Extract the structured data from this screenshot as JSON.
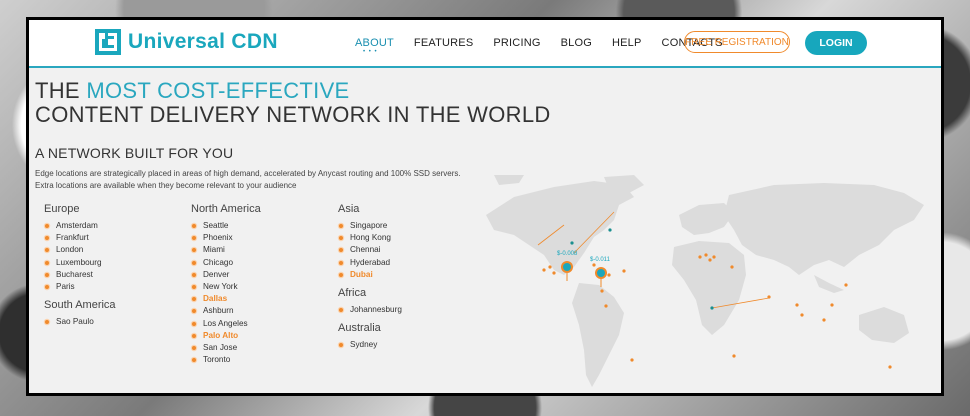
{
  "brand": {
    "name": "Universal CDN",
    "accent": "#1aa7bd",
    "orange": "#f08a2c"
  },
  "nav": {
    "items": [
      "ABOUT",
      "FEATURES",
      "PRICING",
      "BLOG",
      "HELP",
      "CONTACTS"
    ],
    "active": "ABOUT",
    "register": "FREE REGISTRATION",
    "login": "LOGIN"
  },
  "hero": {
    "line1_prefix": "THE ",
    "line1_highlight": "MOST COST-EFFECTIVE",
    "line2": "CONTENT DELIVERY NETWORK IN THE WORLD"
  },
  "section": {
    "title": "A NETWORK BUILT FOR YOU",
    "desc1": "Edge locations are strategically placed in areas of high demand, accelerated by Anycast routing and 100% SSD servers.",
    "desc2": "Extra locations are available when they become relevant to your audience"
  },
  "regions": {
    "europe": {
      "name": "Europe",
      "locations": [
        "Amsterdam",
        "Frankfurt",
        "London",
        "Luxembourg",
        "Bucharest",
        "Paris"
      ]
    },
    "south_america": {
      "name": "South America",
      "locations": [
        "Sao Paulo"
      ]
    },
    "north_america": {
      "name": "North America",
      "locations": [
        "Seattle",
        "Phoenix",
        "Miami",
        "Chicago",
        "Denver",
        "New York",
        "Dallas",
        "Ashburn",
        "Los Angeles",
        "Palo Alto",
        "San Jose",
        "Toronto"
      ],
      "highlighted": [
        "Dallas",
        "Palo Alto"
      ]
    },
    "asia": {
      "name": "Asia",
      "locations": [
        "Singapore",
        "Hong Kong",
        "Chennai",
        "Hyderabad",
        "Dubai"
      ],
      "highlighted": [
        "Dubai"
      ]
    },
    "africa": {
      "name": "Africa",
      "locations": [
        "Johannesburg"
      ]
    },
    "australia": {
      "name": "Australia",
      "locations": [
        "Sydney"
      ]
    }
  },
  "map": {
    "price_tag_1": "$-0.008",
    "price_tag_2": "$-0.011"
  }
}
